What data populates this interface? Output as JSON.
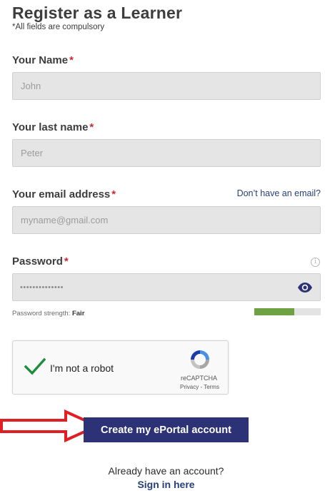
{
  "page": {
    "title": "Register as a Learner",
    "subtitle": "*All fields are compulsory"
  },
  "form": {
    "first_name": {
      "label": "Your Name",
      "required_mark": "*",
      "placeholder": "John"
    },
    "last_name": {
      "label": "Your last name",
      "required_mark": "*",
      "placeholder": "Peter"
    },
    "email": {
      "label": "Your email address",
      "required_mark": "*",
      "placeholder": "myname@gmail.com",
      "no_email_link": "Don’t have an email?"
    },
    "password": {
      "label": "Password",
      "required_mark": "*",
      "masked_value": "••••••••••••••",
      "info_icon": "i"
    },
    "strength": {
      "label": "Password strength:",
      "value": "Fair",
      "level": 0.6
    }
  },
  "captcha": {
    "label": "I'm not a robot",
    "brand": "reCAPTCHA",
    "links": "Privacy - Terms",
    "checked": true
  },
  "actions": {
    "submit_label": "Create my ePortal account",
    "already_text": "Already have an account?",
    "signin_label": "Sign in here"
  },
  "colors": {
    "primary_button": "#2c3275",
    "required": "#d0282e",
    "link": "#26417a",
    "strength_fill": "#6da142",
    "annotation_arrow": "#e01e24"
  },
  "icons": [
    "info-icon",
    "eye-icon",
    "checkmark-icon",
    "recaptcha-logo-icon",
    "red-arrow-icon"
  ]
}
